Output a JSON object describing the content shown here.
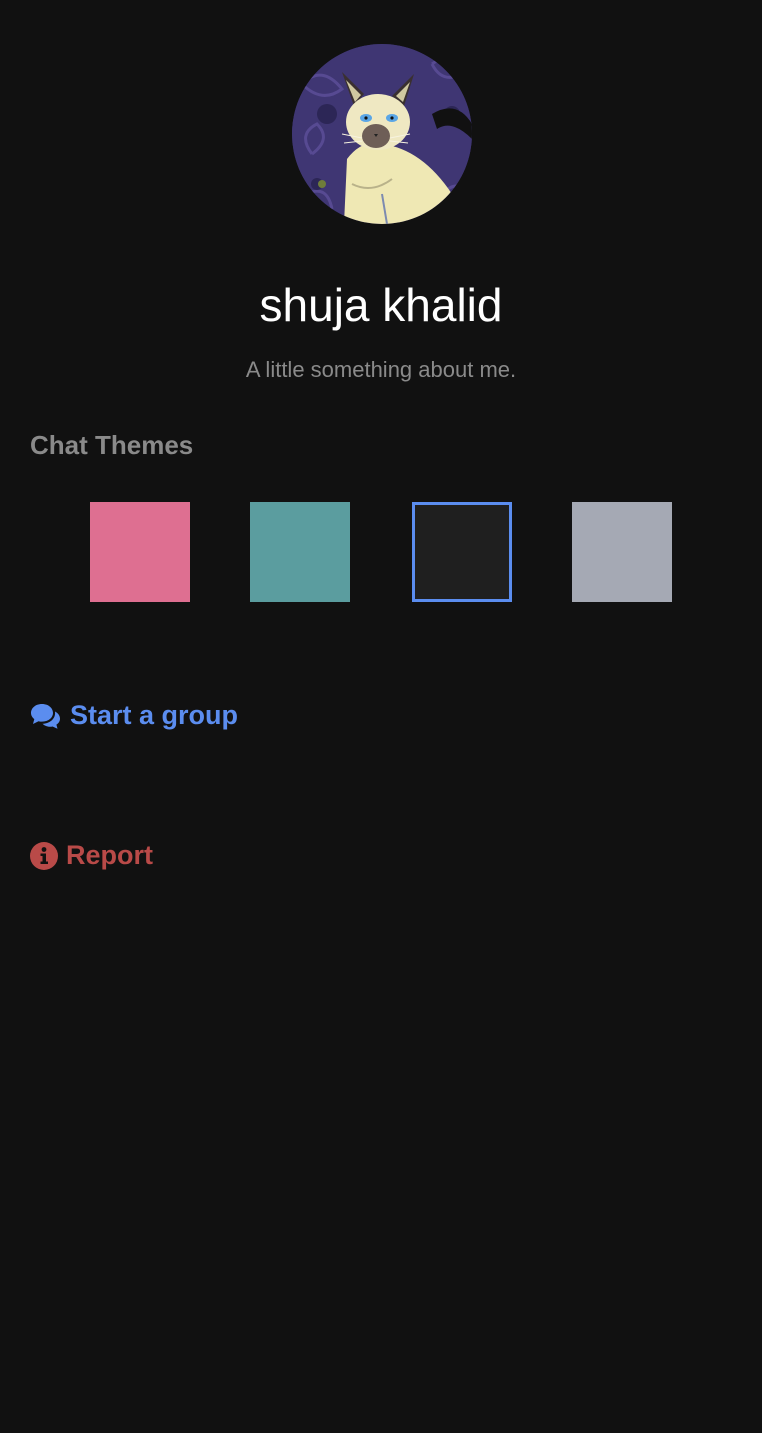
{
  "profile": {
    "name": "shuja khalid",
    "bio": "A little something about me."
  },
  "chat_themes": {
    "title": "Chat Themes",
    "swatches": [
      {
        "color": "#de6f91",
        "selected": false
      },
      {
        "color": "#5b9d9f",
        "selected": false
      },
      {
        "color": "#1f1f1f",
        "selected": true
      },
      {
        "color": "#a5a9b4",
        "selected": false
      }
    ],
    "selected_border": "#5b8def"
  },
  "actions": {
    "start_group_label": "Start a group",
    "start_group_icon": "comments-icon",
    "report_label": "Report",
    "report_icon": "info-circle-icon"
  },
  "colors": {
    "background": "#111111",
    "link": "#5b8def",
    "danger": "#b94a48",
    "muted": "#8a8a8a"
  }
}
